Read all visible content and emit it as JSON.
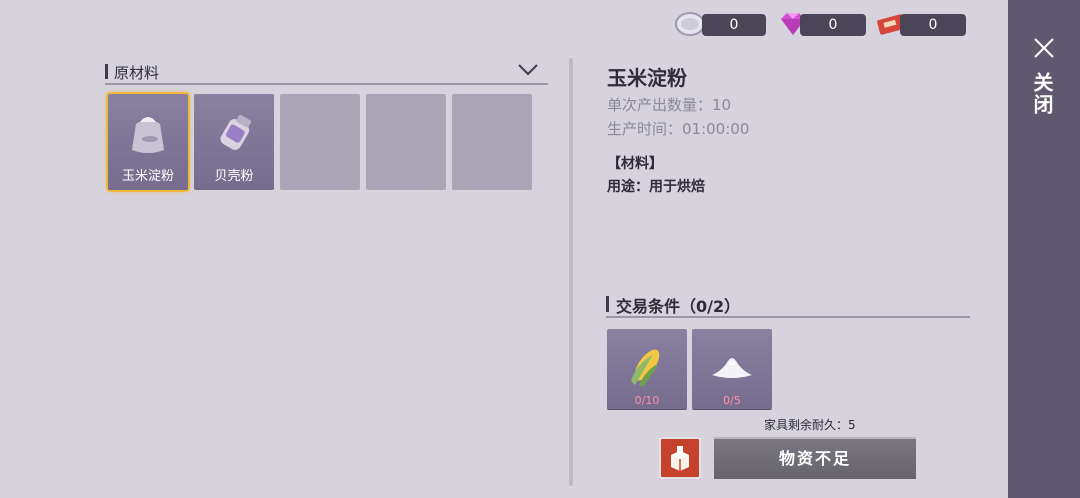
{
  "currencies": [
    {
      "icon": "coin-icon",
      "value": "0"
    },
    {
      "icon": "gem-icon",
      "value": "0"
    },
    {
      "icon": "ticket-icon",
      "value": "0"
    }
  ],
  "close": {
    "label": "关闭"
  },
  "materials": {
    "title": "原材料",
    "slots": [
      {
        "label": "玉米淀粉",
        "icon": "starch-bag-icon",
        "selected": true
      },
      {
        "label": "贝壳粉",
        "icon": "powder-jar-icon",
        "selected": false
      },
      {
        "label": "",
        "icon": ""
      },
      {
        "label": "",
        "icon": ""
      },
      {
        "label": "",
        "icon": ""
      }
    ]
  },
  "detail": {
    "title": "玉米淀粉",
    "output_qty": "单次产出数量：10",
    "production_time": "生产时间：01:00:00",
    "category": "【材料】",
    "usage": "用途：用于烘焙"
  },
  "trade": {
    "title": "交易条件（0/2）",
    "requirements": [
      {
        "icon": "corn-icon",
        "count": "0/10"
      },
      {
        "icon": "flour-pile-icon",
        "count": "0/5"
      }
    ]
  },
  "footer": {
    "durability": "家具剩余耐久：5",
    "action_label": "物资不足"
  },
  "colors": {
    "background": "#d6d3dd",
    "close_panel": "#5f586f",
    "slot_filled": "#7f7596",
    "selected_border": "#f3b73e",
    "requirement_count": "#ff8fa8",
    "red_button": "#c5432d"
  }
}
